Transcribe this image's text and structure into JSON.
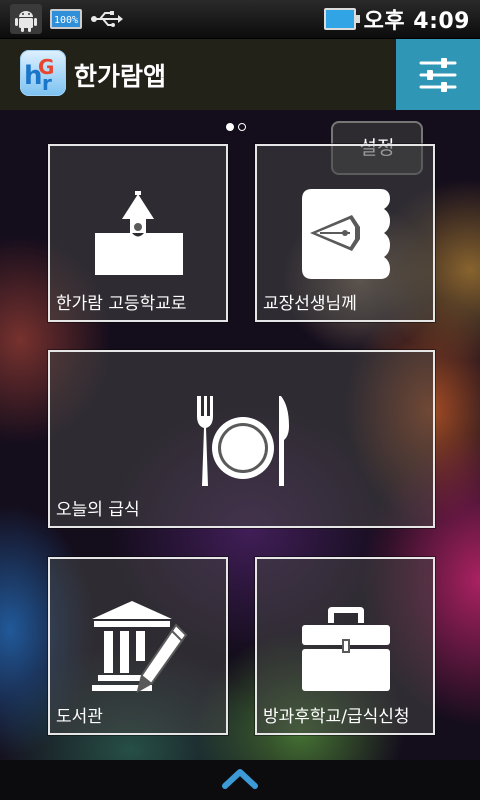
{
  "status_bar": {
    "battery_percent_label": "100%",
    "time": "오후 4:09",
    "icons": [
      "android-icon",
      "battery-icon",
      "usb-icon",
      "battery-icon"
    ]
  },
  "action_bar": {
    "app_title": "한가람앱",
    "logo_icon": "app-logo-icon",
    "settings_icon": "sliders-icon"
  },
  "pager": {
    "current_page": 1,
    "page_count": 2
  },
  "settings_button": {
    "label": "설정"
  },
  "tiles": [
    {
      "label": "한가람 고등학교로",
      "icon": "school-icon"
    },
    {
      "label": "교장선생님께",
      "icon": "pen-nib-icon"
    },
    {
      "label": "오늘의 급식",
      "icon": "meal-icon"
    },
    {
      "label": "도서관",
      "icon": "library-icon"
    },
    {
      "label": "방과후학교/급식신청",
      "icon": "briefcase-icon"
    }
  ],
  "bottom_bar": {
    "icon": "chevron-up-icon"
  },
  "colors": {
    "action_bar_bg": "#222219",
    "settings_accent": "#2f96b6",
    "tile_border": "#e6e6e6"
  }
}
